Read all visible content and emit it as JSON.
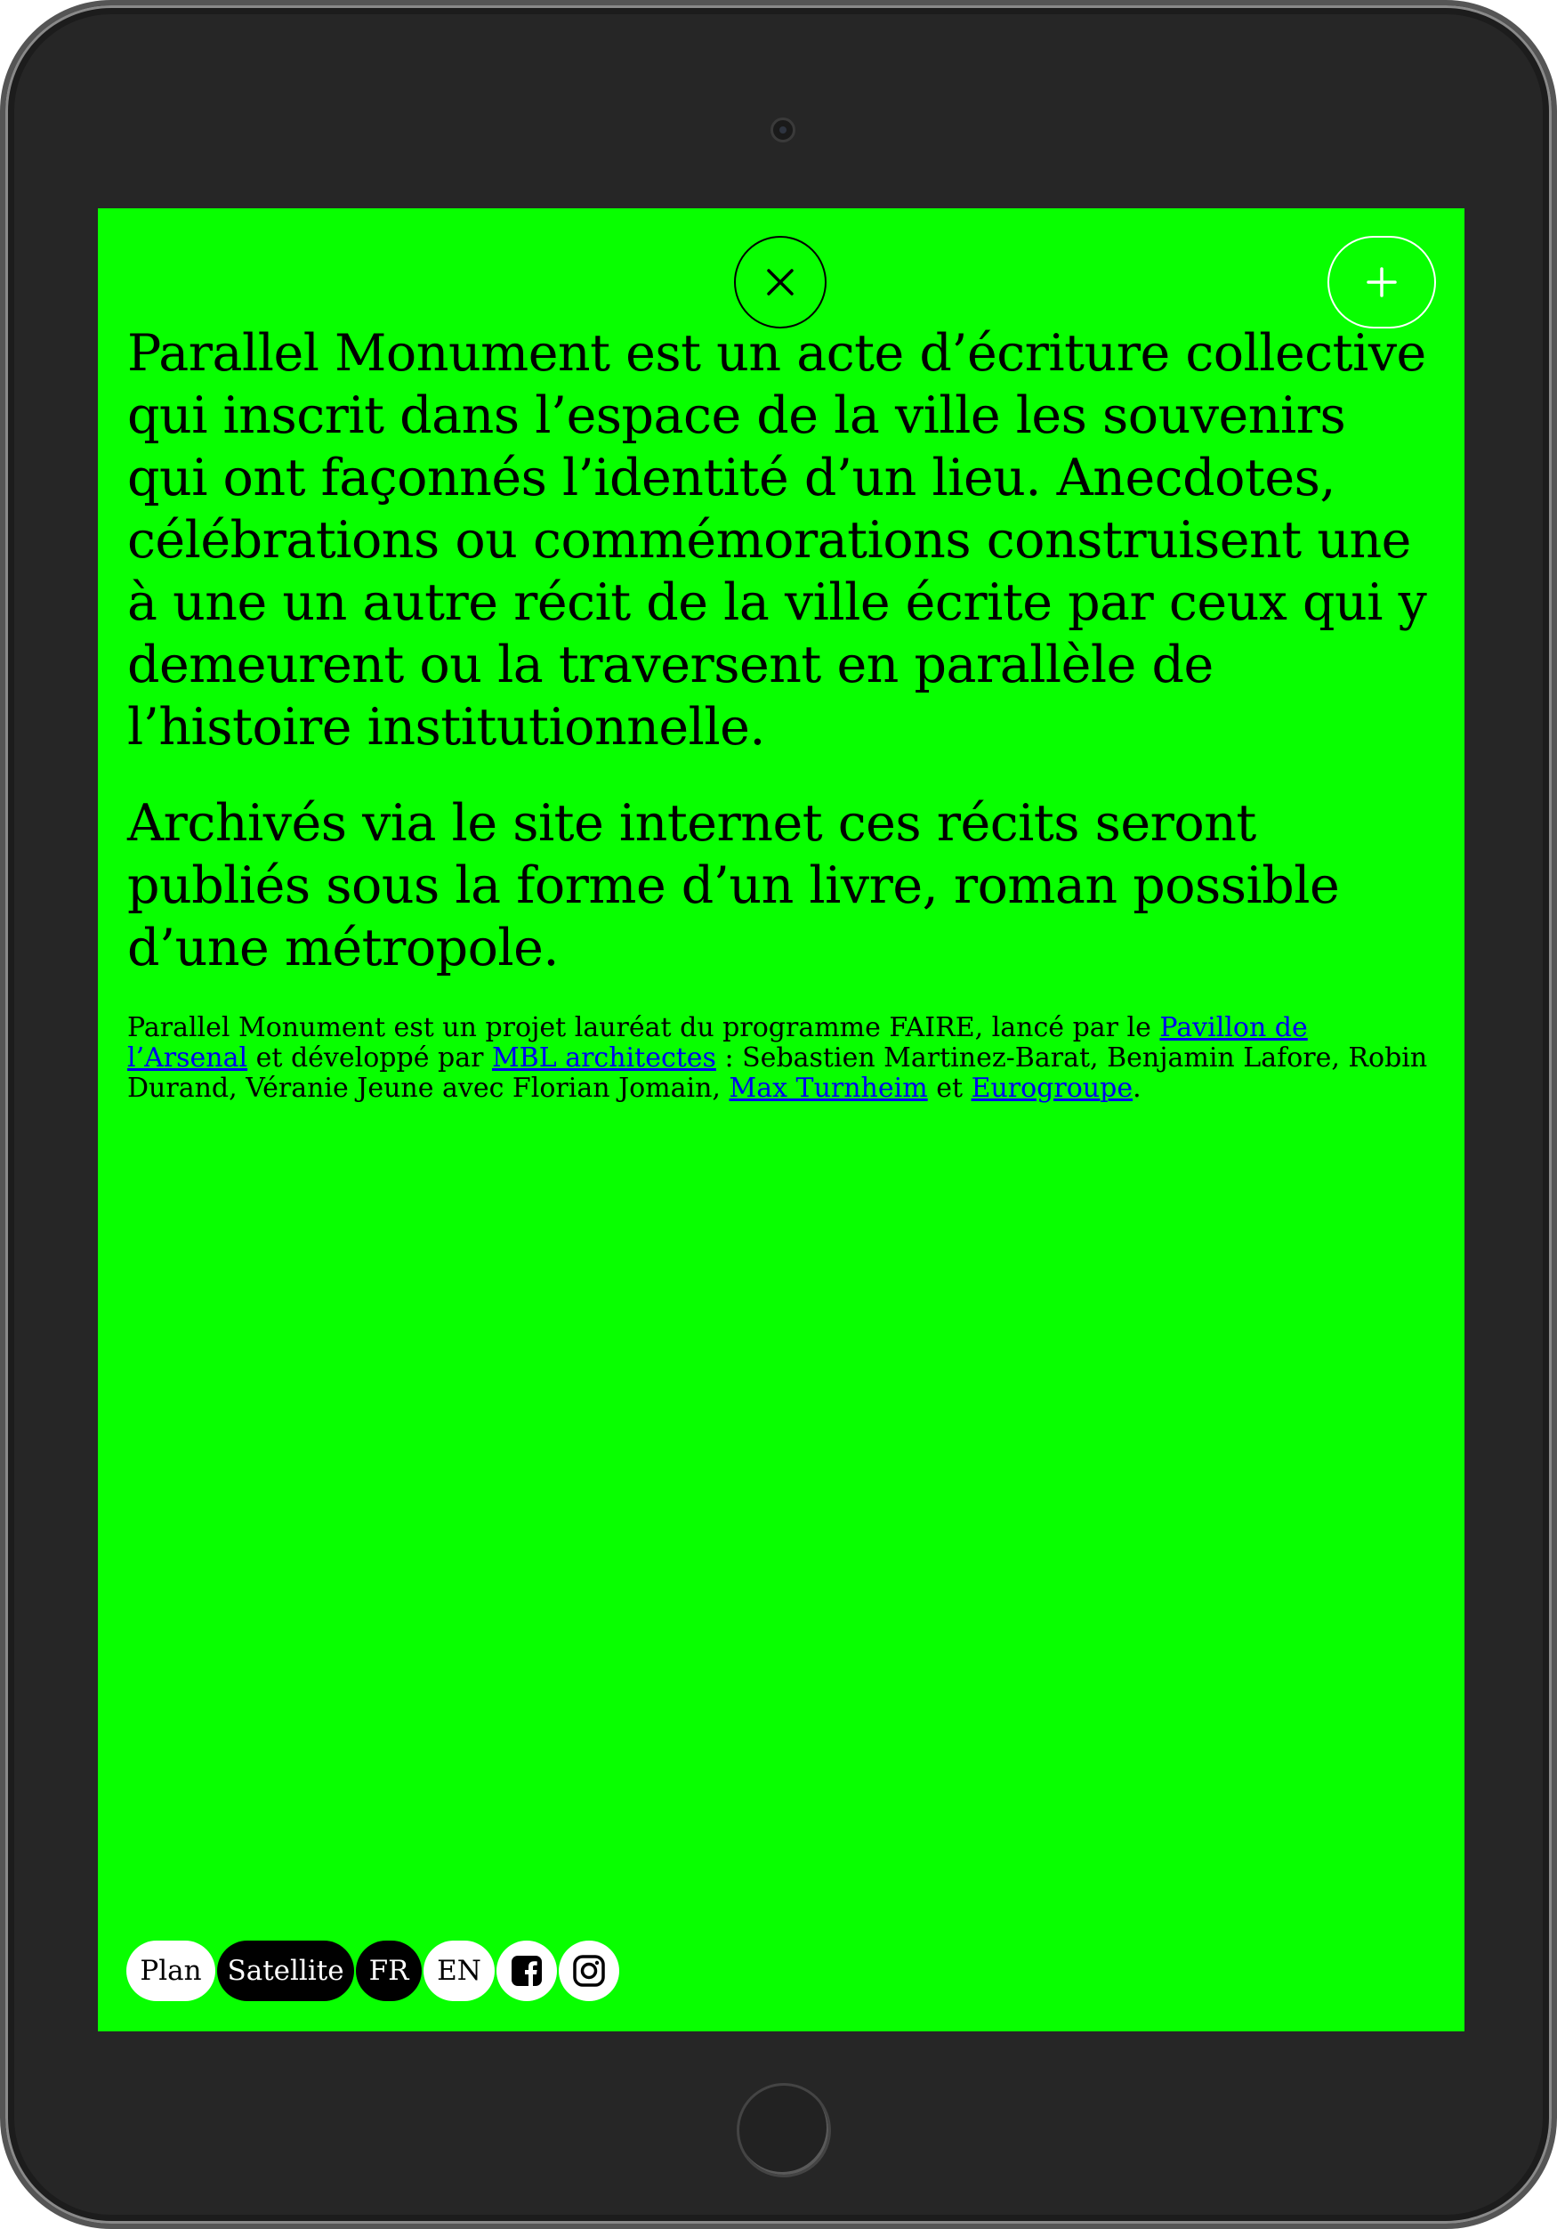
{
  "screen": {
    "background": "#08ff00",
    "close_icon": "close-icon",
    "add_icon": "plus-icon"
  },
  "intro": {
    "paragraph_1": "Parallel Monument est un acte d’écriture collective qui inscrit dans l’espace de la ville les souvenirs qui ont façonnés l’identité d’un lieu. Anecdotes, célébrations ou commémorations construisent une à une un autre récit de la ville écrite par ceux qui y demeurent ou la traversent en parallèle de l’histoire institutionnelle.",
    "paragraph_2": "Archivés via le site internet ces récits seront publiés sous la forme d’un livre, roman possible d’une métropole."
  },
  "credits": {
    "part_1": "Parallel Monument est un projet lauréat du programme FAIRE, lancé par le ",
    "link_pavillon": "Pavillon de l’Arsenal",
    "part_2": " et développé par ",
    "link_mbl": "MBL architectes",
    "part_3": " : Sebastien Martinez-Barat, Benjamin Lafore, Robin Durand, Véranie Jeune avec Florian Jomain, ",
    "link_max": "Max Turnheim",
    "part_4": " et ",
    "link_eurogroupe": "Eurogroupe",
    "part_5": "."
  },
  "toolbar": {
    "plan_label": "Plan",
    "satellite_label": "Satellite",
    "fr_label": "FR",
    "en_label": "EN",
    "facebook_icon": "facebook-icon",
    "instagram_icon": "instagram-icon"
  }
}
